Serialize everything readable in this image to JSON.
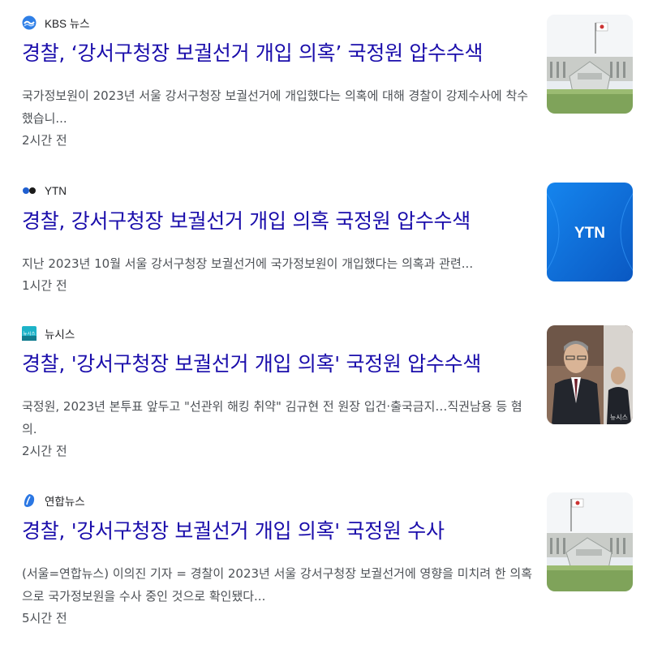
{
  "articles": [
    {
      "source": "KBS 뉴스",
      "source_icon": "kbs-logo-icon",
      "headline": "경찰, ‘강서구청장 보궐선거 개입 의혹’ 국정원 압수수색",
      "snippet": "국가정보원이 2023년 서울 강서구청장 보궐선거에 개입했다는 의혹에 대해 경찰이 강제수사에 착수했습니...",
      "time": "2시간 전",
      "thumbnail": "nis-building-image"
    },
    {
      "source": "YTN",
      "source_icon": "ytn-logo-icon",
      "headline": "경찰, 강서구청장 보궐선거 개입 의혹 국정원 압수수색",
      "snippet": "지난 2023년 10월 서울 강서구청장 보궐선거에 국가정보원이 개입했다는 의혹과 관련...",
      "time": "1시간 전",
      "thumbnail": "ytn-logo-image",
      "thumbnail_text": "YTN"
    },
    {
      "source": "뉴시스",
      "source_icon": "newsis-logo-icon",
      "source_icon_text": "뉴시스",
      "headline": "경찰, '강서구청장 보궐선거 개입 의혹' 국정원 압수수색",
      "snippet": "국정원, 2023년 본투표 앞두고 \"선관위 해킹 취약\" 김규현 전 원장 입건·출국금지…직권남용 등 혐의.",
      "time": "2시간 전",
      "thumbnail": "official-portrait-image",
      "thumbnail_watermark": "뉴시스"
    },
    {
      "source": "연합뉴스",
      "source_icon": "yonhap-logo-icon",
      "headline": "경찰, '강서구청장 보궐선거 개입 의혹' 국정원 수사",
      "snippet": "(서울=연합뉴스) 이의진 기자 = 경찰이 2023년 서울 강서구청장 보궐선거에 영향을 미치려 한 의혹으로 국가정보원을 수사 중인 것으로 확인됐다...",
      "time": "5시간 전",
      "thumbnail": "nis-building-image"
    }
  ],
  "colors": {
    "link": "#1a0dab",
    "text": "#4d5156",
    "ytn_blue": "#0f6fd8"
  }
}
